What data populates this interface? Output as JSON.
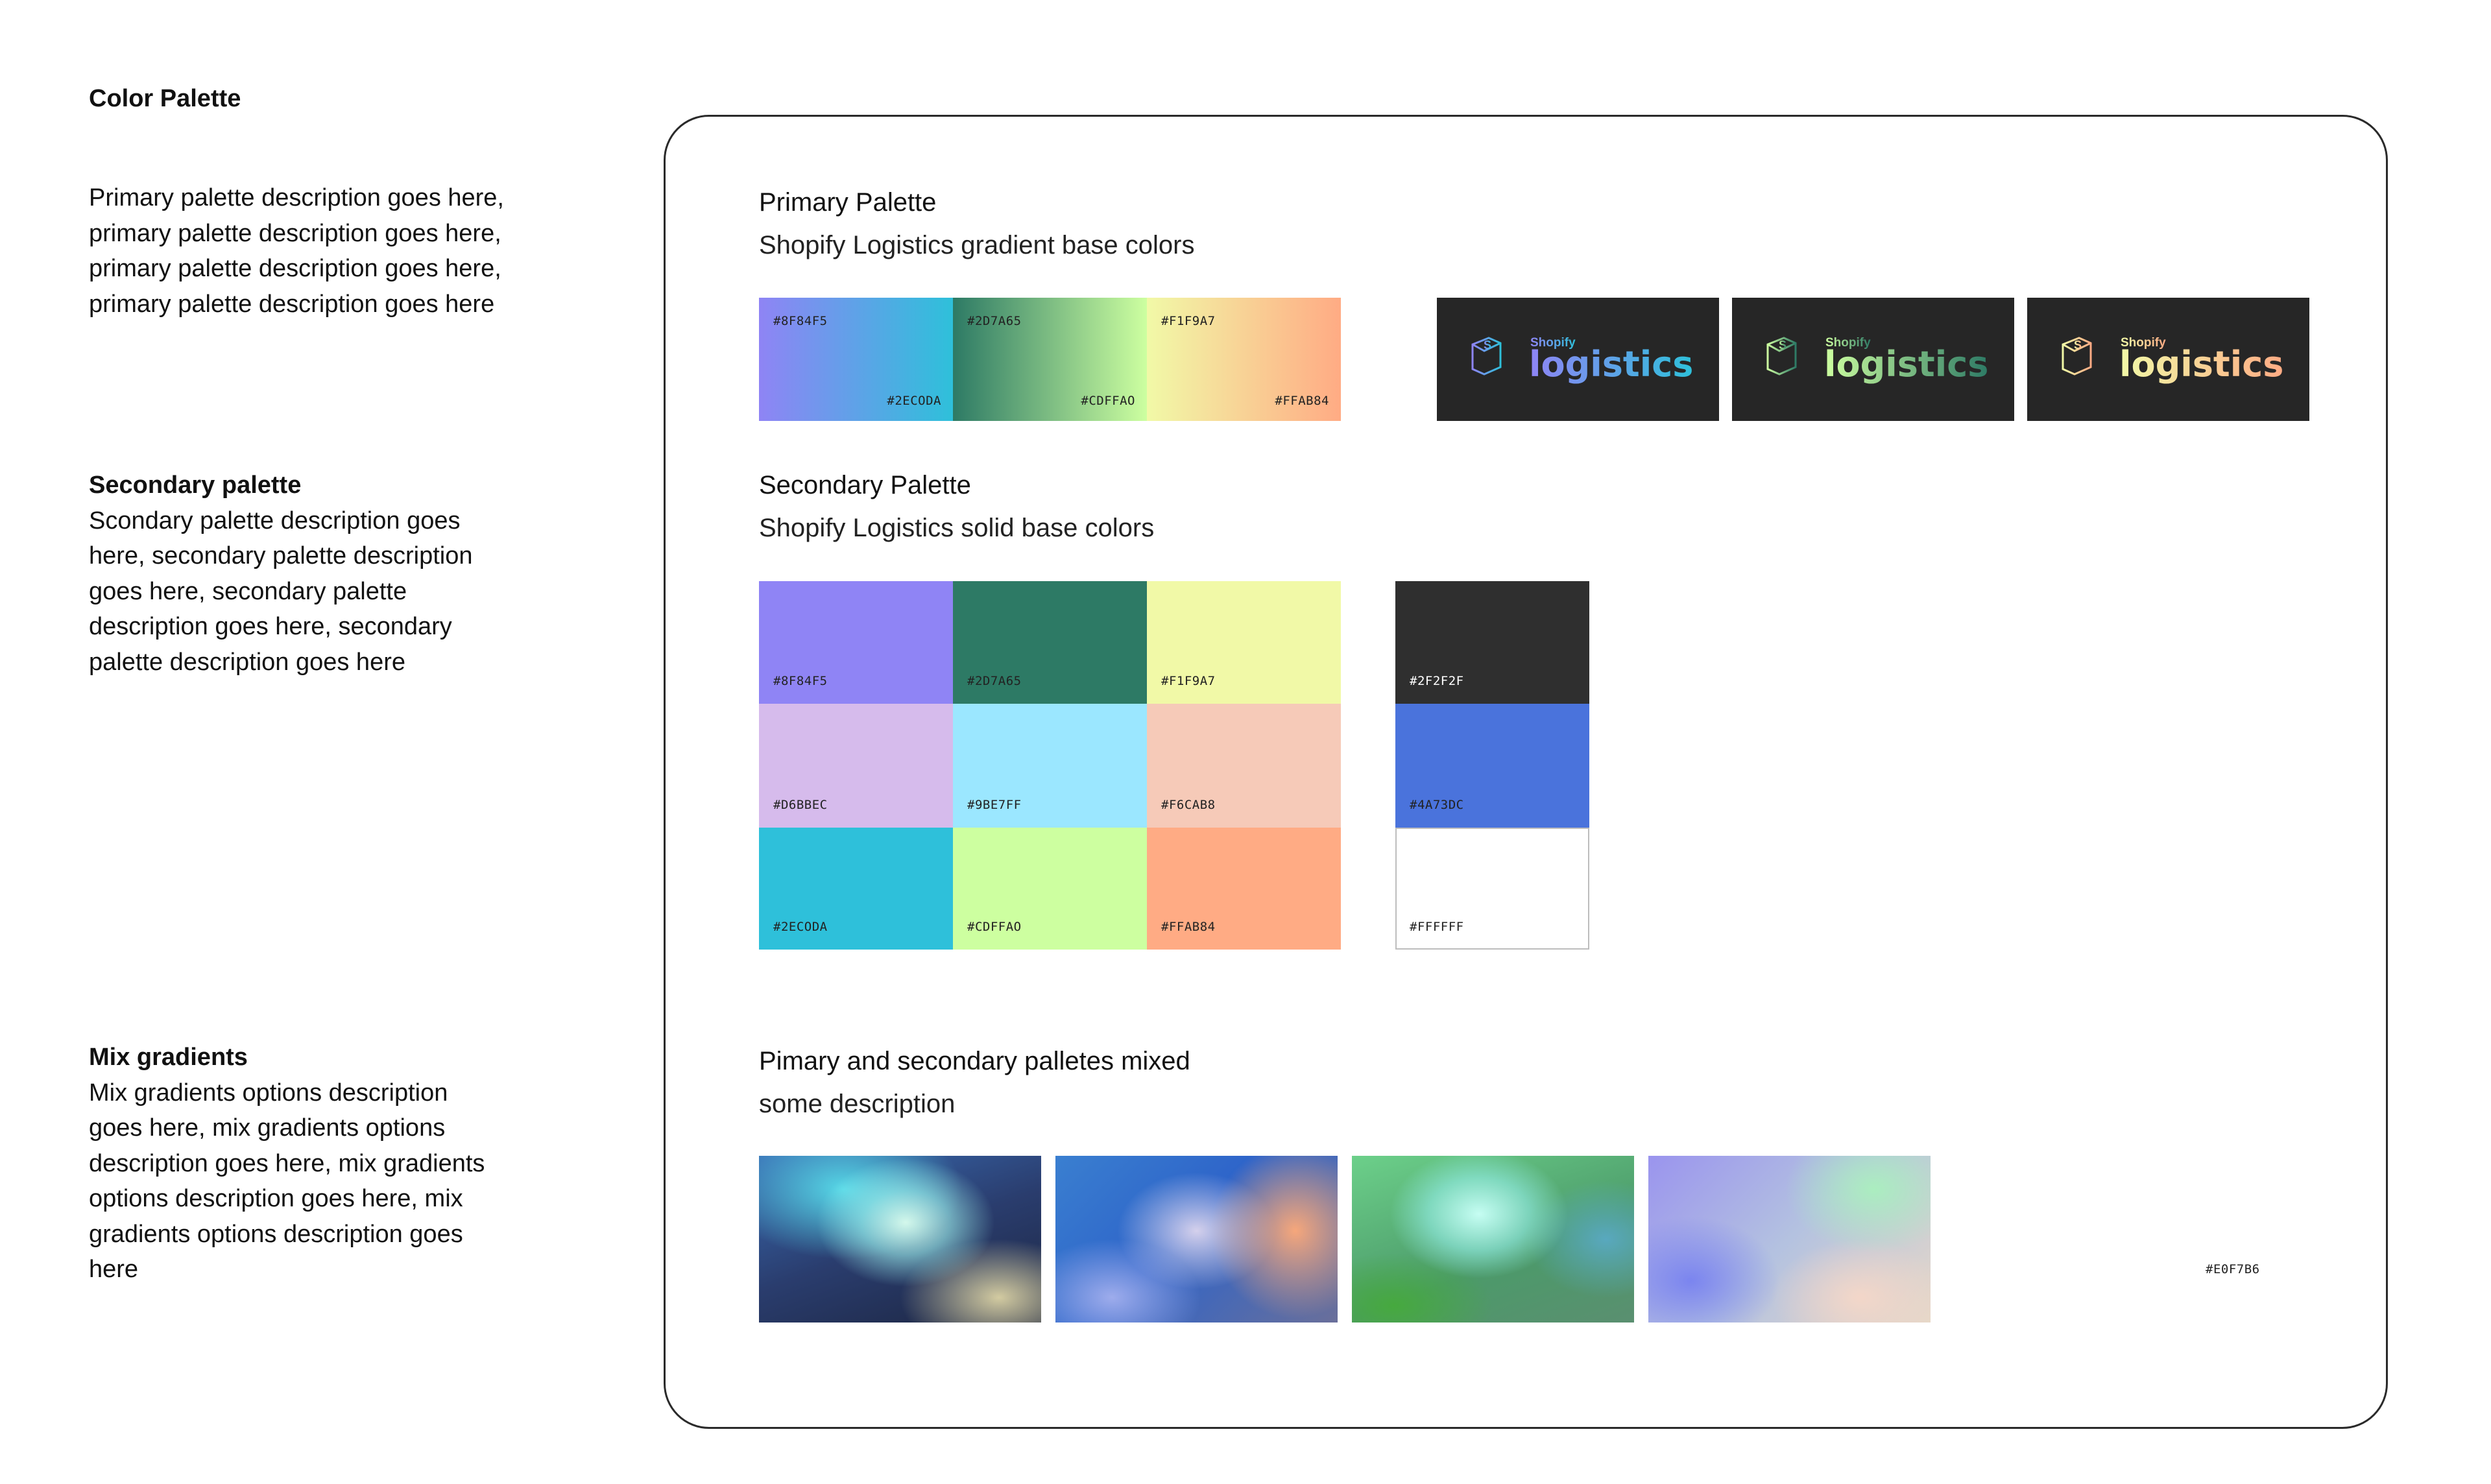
{
  "page": {
    "title": "Color Palette"
  },
  "sidebar": {
    "primary": {
      "description": "Primary palette description goes here, primary palette description goes here, primary palette description goes here, primary palette description goes here"
    },
    "secondary": {
      "heading": "Secondary palette",
      "description": "Scondary palette description goes here, secondary palette description goes here, secondary palette description goes here, secondary palette description goes here"
    },
    "mix": {
      "heading": "Mix gradients",
      "description": "Mix gradients options description goes here, mix gradients options description goes here, mix gradients options description goes here, mix gradients options description goes here"
    }
  },
  "primary_palette": {
    "title": "Primary Palette",
    "subtitle": "Shopify Logistics gradient base colors",
    "gradients": [
      {
        "start": "#8F84F5",
        "end": "#2ECODA",
        "start_color": "#8F84F5",
        "end_color": "#2EC0DA"
      },
      {
        "start": "#2D7A65",
        "end": "#CDFFAO",
        "start_color": "#2D7A65",
        "end_color": "#CDFFA0"
      },
      {
        "start": "#F1F9A7",
        "end": "#FFAB84",
        "start_color": "#F1F9A7",
        "end_color": "#FFAB84"
      }
    ],
    "logos": [
      {
        "brand": "Shopify",
        "word": "logistics",
        "icon": "box-s-logo-icon",
        "c1": "#8F84F5",
        "c2": "#2EC0DA"
      },
      {
        "brand": "Shopify",
        "word": "logistics",
        "icon": "box-s-logo-icon",
        "c1": "#CDFFA0",
        "c2": "#2D7A65"
      },
      {
        "brand": "Shopify",
        "word": "logistics",
        "icon": "box-s-logo-icon",
        "c1": "#F1F9A7",
        "c2": "#FFAB84"
      }
    ]
  },
  "secondary_palette": {
    "title": "Secondary Palette",
    "subtitle": "Shopify Logistics solid base colors",
    "grid": [
      {
        "label": "#8F84F5",
        "color": "#8F84F5"
      },
      {
        "label": "#2D7A65",
        "color": "#2D7A65"
      },
      {
        "label": "#F1F9A7",
        "color": "#F1F9A7"
      },
      {
        "label": "#D6BBEC",
        "color": "#D6BBEC"
      },
      {
        "label": "#9BE7FF",
        "color": "#9BE7FF"
      },
      {
        "label": "#F6CAB8",
        "color": "#F6CAB8"
      },
      {
        "label": "#2ECODA",
        "color": "#2EC0DA"
      },
      {
        "label": "#CDFFAO",
        "color": "#CDFFA0"
      },
      {
        "label": "#FFAB84",
        "color": "#FFAB84"
      }
    ],
    "neutrals": [
      {
        "label": "#2F2F2F",
        "color": "#2F2F2F"
      },
      {
        "label": "#4A73DC",
        "color": "#4A73DC"
      },
      {
        "label": "#FFFFFF",
        "color": "#FFFFFF"
      }
    ]
  },
  "mixed": {
    "title": "Pimary and secondary palletes mixed",
    "subtitle": "some description",
    "extra_hex": "#E0F7B6"
  }
}
